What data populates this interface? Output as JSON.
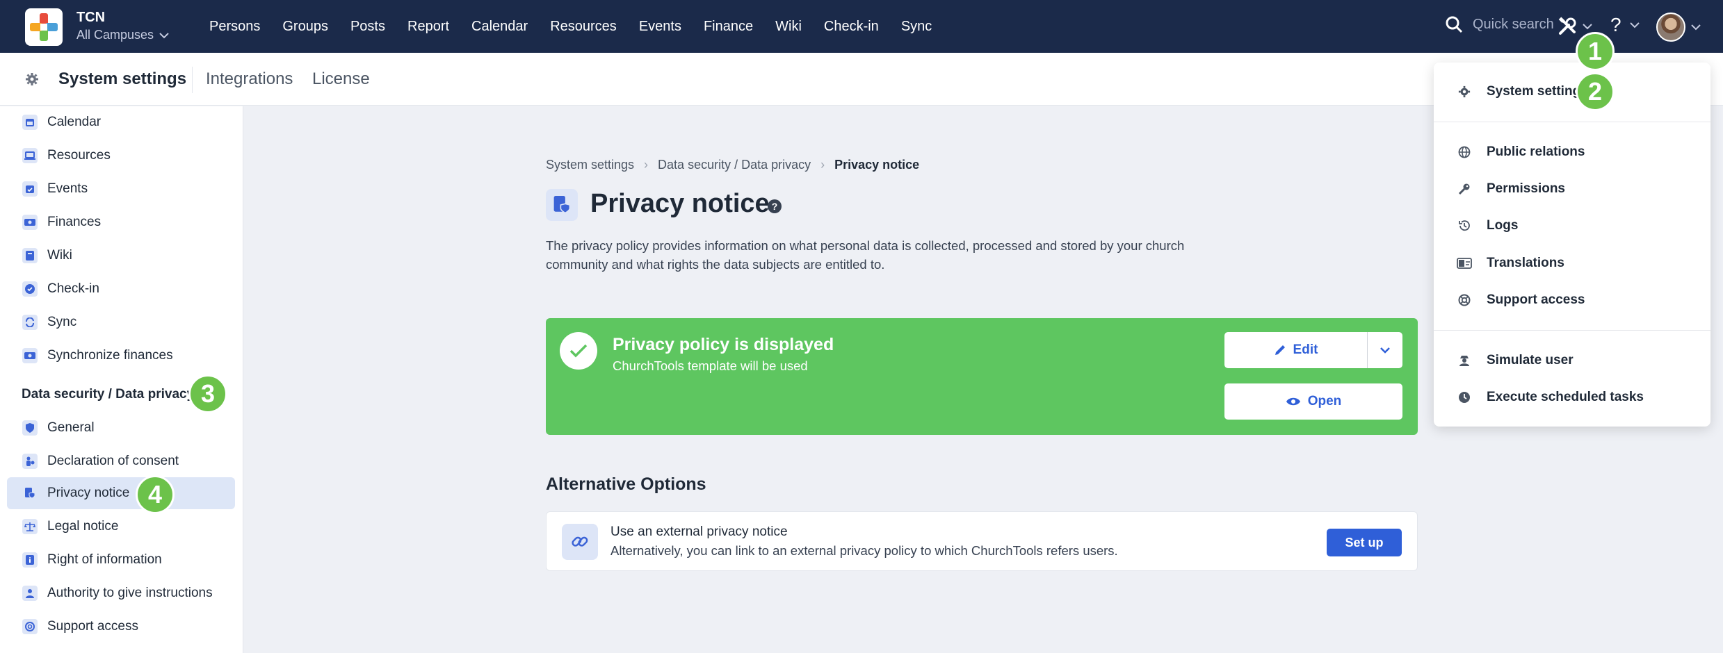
{
  "topbar": {
    "org_name": "TCN",
    "campus": "All Campuses",
    "nav": [
      "Persons",
      "Groups",
      "Posts",
      "Report",
      "Calendar",
      "Resources",
      "Events",
      "Finance",
      "Wiki",
      "Check-in",
      "Sync"
    ],
    "search_placeholder": "Quick search",
    "help_label": "?"
  },
  "subbar": {
    "title": "System settings",
    "links": [
      "Integrations",
      "License"
    ]
  },
  "sidebar": {
    "items_top": [
      {
        "label": "Calendar",
        "icon": "calendar-icon"
      },
      {
        "label": "Resources",
        "icon": "laptop-icon"
      },
      {
        "label": "Events",
        "icon": "calendar-check-icon"
      },
      {
        "label": "Finances",
        "icon": "money-icon"
      },
      {
        "label": "Wiki",
        "icon": "book-icon"
      },
      {
        "label": "Check-in",
        "icon": "check-circle-icon"
      },
      {
        "label": "Sync",
        "icon": "sync-icon"
      },
      {
        "label": "Synchronize finances",
        "icon": "money-sync-icon"
      }
    ],
    "section_heading": "Data security / Data privacy",
    "items_bottom": [
      {
        "label": "General",
        "icon": "shield-icon"
      },
      {
        "label": "Declaration of consent",
        "icon": "person-consent-icon"
      },
      {
        "label": "Privacy notice",
        "icon": "file-shield-icon"
      },
      {
        "label": "Legal notice",
        "icon": "scales-icon"
      },
      {
        "label": "Right of information",
        "icon": "book-info-icon"
      },
      {
        "label": "Authority to give instructions",
        "icon": "user-tie-icon"
      },
      {
        "label": "Support access",
        "icon": "lifebuoy-icon"
      }
    ]
  },
  "badges": [
    "1",
    "2",
    "3",
    "4"
  ],
  "main": {
    "breadcrumb": [
      "System settings",
      "Data security / Data privacy",
      "Privacy notice"
    ],
    "title": "Privacy notice",
    "help": "?",
    "description": "The privacy policy provides information on what personal data is collected, processed and stored by your church community and what rights the data subjects are entitled to.",
    "status": {
      "title": "Privacy policy is displayed",
      "subtitle": "ChurchTools template will be used",
      "edit_label": "Edit",
      "open_label": "Open",
      "color": "#5ec660"
    },
    "alternatives": {
      "heading": "Alternative Options",
      "item_title": "Use an external privacy notice",
      "item_desc": "Alternatively, you can link to an external privacy policy to which ChurchTools refers users.",
      "button": "Set up"
    }
  },
  "dropdown": {
    "items": [
      {
        "label": "System settings",
        "icon": "gear-icon"
      },
      {
        "label": "Public relations",
        "icon": "globe-icon"
      },
      {
        "label": "Permissions",
        "icon": "key-icon"
      },
      {
        "label": "Logs",
        "icon": "history-icon"
      },
      {
        "label": "Translations",
        "icon": "language-icon"
      },
      {
        "label": "Support access",
        "icon": "lifebuoy-icon"
      },
      {
        "label": "Simulate user",
        "icon": "user-secret-icon"
      },
      {
        "label": "Execute scheduled tasks",
        "icon": "clock-icon"
      }
    ]
  },
  "colors": {
    "navbar": "#1b2a4a",
    "accent": "#2f5fd8",
    "success": "#5ec660",
    "badge": "#6cc24a"
  }
}
